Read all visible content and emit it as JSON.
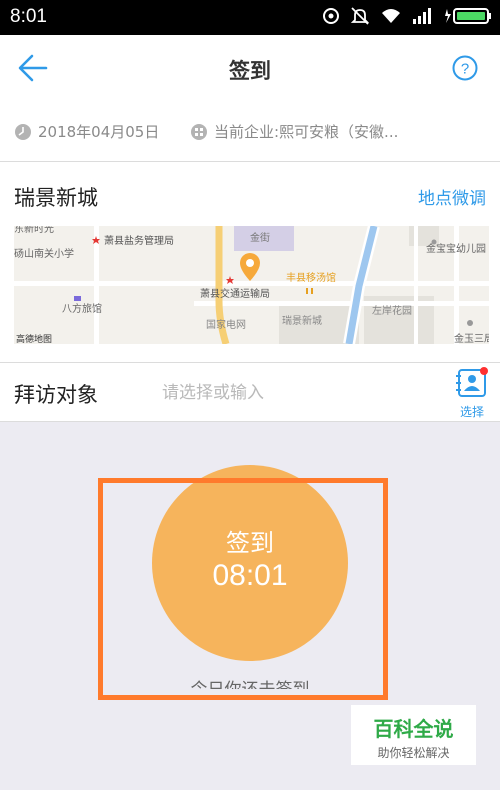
{
  "status_bar": {
    "time": "8:01"
  },
  "nav": {
    "title": "签到"
  },
  "info": {
    "date": "2018年04月05日",
    "company": "当前企业:熙可安粮（安徽..."
  },
  "location": {
    "name": "瑞景新城",
    "adjust_label": "地点微调",
    "map_labels": [
      "东新时光",
      "砀山南关小学",
      "萧县盐务管理局",
      "萧县交通运输局",
      "丰县移汤馆",
      "金宝宝幼儿园",
      "八方旅馆",
      "国家电网",
      "瑞景新城",
      "左岸花园",
      "金玉三局",
      "高德地图",
      "金街"
    ]
  },
  "visit": {
    "label": "拜访对象",
    "placeholder": "请选择或输入",
    "select_label": "选择"
  },
  "checkin": {
    "title": "签到",
    "time": "08:01",
    "status_text": "今日你还未签到"
  },
  "watermark": {
    "title": "百科全说",
    "subtitle": "助你轻松解决"
  },
  "colors": {
    "accent": "#2f9ae8",
    "circle": "#f6b45c",
    "highlight": "#ff7a2c",
    "background": "#ecebf2"
  }
}
